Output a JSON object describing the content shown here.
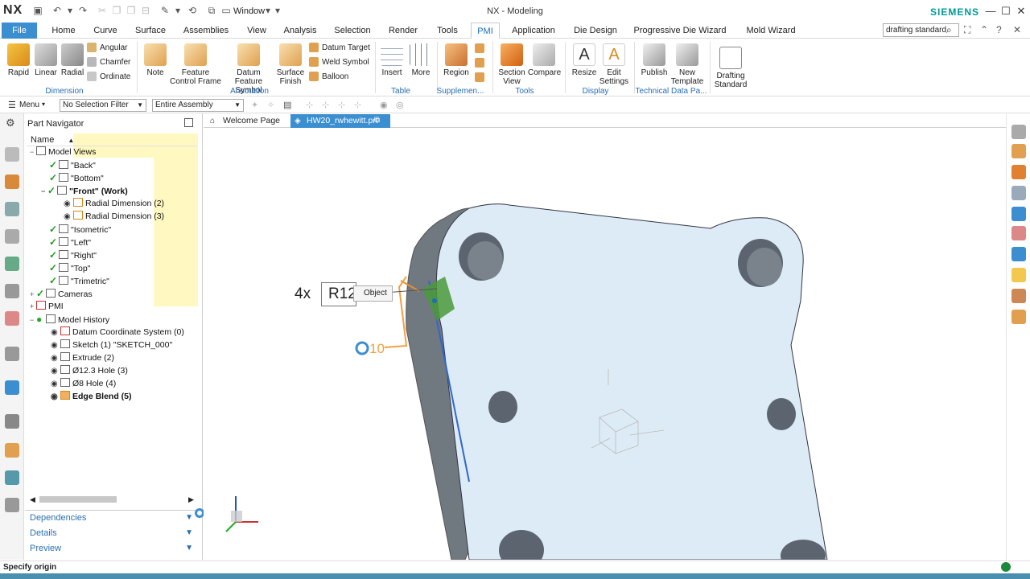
{
  "app": {
    "logo": "NX",
    "title": "NX - Modeling",
    "brand": "SIEMENS",
    "window_menu": "Window"
  },
  "tabs": [
    "File",
    "Home",
    "Curve",
    "Surface",
    "Assemblies",
    "View",
    "Analysis",
    "Selection",
    "Render",
    "Tools",
    "PMI",
    "Application",
    "Die Design",
    "Progressive Die Wizard",
    "Mold Wizard"
  ],
  "active_tab": "PMI",
  "search": {
    "value": "drafting standard"
  },
  "ribbon": {
    "dimension": {
      "label": "Dimension",
      "rapid": "Rapid",
      "linear": "Linear",
      "radial": "Radial",
      "angular": "Angular",
      "chamfer": "Chamfer",
      "ordinate": "Ordinate"
    },
    "annotation": {
      "label": "Annotation",
      "note": "Note",
      "feature_control_frame": "Feature Control Frame",
      "datum_feature_symbol": "Datum Feature Symbol",
      "surface_finish": "Surface Finish",
      "datum_target": "Datum Target",
      "weld_symbol": "Weld Symbol",
      "balloon": "Balloon"
    },
    "table": {
      "label": "Table",
      "insert": "Insert",
      "more": "More"
    },
    "supplemental": {
      "label": "Supplemen...",
      "region": "Region"
    },
    "tools": {
      "label": "Tools",
      "section_view": "Section View",
      "compare": "Compare"
    },
    "display": {
      "label": "Display",
      "resize": "Resize",
      "edit_settings": "Edit Settings"
    },
    "technical": {
      "label": "Technical Data Pa...",
      "publish": "Publish",
      "new_template": "New Template"
    },
    "drafting_standard": "Drafting Standard"
  },
  "selbar": {
    "menu": "Menu",
    "filter": "No Selection Filter",
    "scope": "Entire Assembly"
  },
  "navigator": {
    "title": "Part Navigator",
    "column": "Name",
    "rows": [
      {
        "label": "Model Views"
      },
      {
        "label": "\"Back\""
      },
      {
        "label": "\"Bottom\""
      },
      {
        "label": "\"Front\" (Work)"
      },
      {
        "label": "Radial Dimension (2)"
      },
      {
        "label": "Radial Dimension (3)"
      },
      {
        "label": "\"Isometric\""
      },
      {
        "label": "\"Left\""
      },
      {
        "label": "\"Right\""
      },
      {
        "label": "\"Top\""
      },
      {
        "label": "\"Trimetric\""
      },
      {
        "label": "Cameras"
      },
      {
        "label": "PMI"
      },
      {
        "label": "Model History"
      },
      {
        "label": "Datum Coordinate System (0)"
      },
      {
        "label": "Sketch (1) \"SKETCH_000\""
      },
      {
        "label": "Extrude (2)"
      },
      {
        "label": "Ø12.3 Hole (3)"
      },
      {
        "label": "Ø8 Hole (4)"
      },
      {
        "label": "Edge Blend (5)"
      }
    ],
    "sections": [
      "Dependencies",
      "Details",
      "Preview"
    ]
  },
  "doc_tabs": [
    "Welcome Page",
    "HW20_rwhewitt.prt"
  ],
  "viewport": {
    "dim_count": "4x",
    "dim_value": "R12",
    "tooltip": "Object",
    "diam_value": "10"
  },
  "status": {
    "text": "Specify origin"
  },
  "colors": {
    "accent": "#3b8fd0",
    "part_face": "#dcebf5",
    "part_side": "#6e7680",
    "highlight": "#4a9a3a",
    "dim_orange": "#f0a040"
  }
}
